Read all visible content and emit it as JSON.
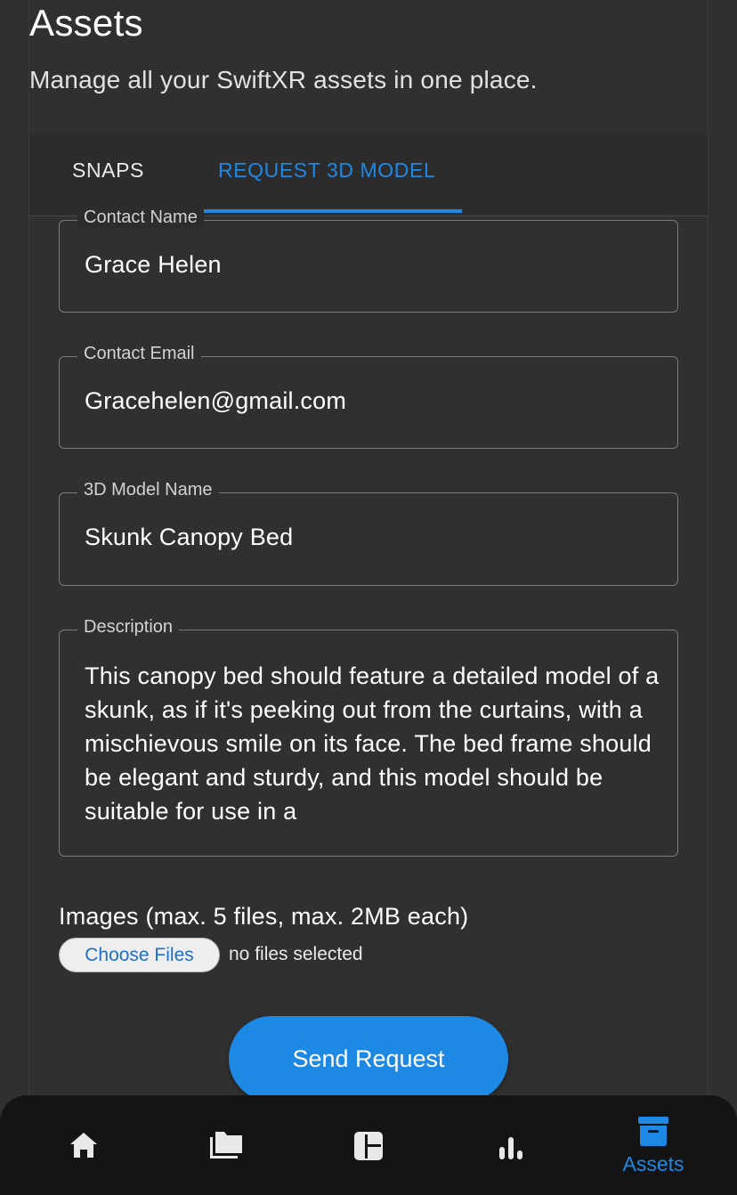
{
  "header": {
    "title": "Assets",
    "subtitle": "Manage all your SwiftXR assets in one place."
  },
  "tabs": [
    {
      "label": "SNAPS",
      "active": false
    },
    {
      "label": "REQUEST 3D MODEL",
      "active": true
    }
  ],
  "form": {
    "contact_name": {
      "label": "Contact Name",
      "value": "Grace Helen"
    },
    "contact_email": {
      "label": "Contact Email",
      "value": "Gracehelen@gmail.com"
    },
    "model_name": {
      "label": "3D Model Name",
      "value": "Skunk Canopy Bed"
    },
    "description": {
      "label": "Description",
      "value": "This canopy bed should feature a detailed model of a skunk, as if it's peeking out from the curtains, with a mischievous smile on its face. The bed frame should be elegant and sturdy, and this model should be suitable for use in a"
    },
    "images": {
      "label": "Images (max. 5 files, max. 2MB each)",
      "button_label": "Choose Files",
      "status": "no files selected"
    },
    "submit_label": "Send Request"
  },
  "bottom_nav": {
    "items": [
      {
        "icon": "home-icon",
        "label": ""
      },
      {
        "icon": "folders-icon",
        "label": ""
      },
      {
        "icon": "dashboard-icon",
        "label": ""
      },
      {
        "icon": "bar-chart-icon",
        "label": ""
      },
      {
        "icon": "archive-icon",
        "label": "Assets",
        "active": true
      }
    ]
  },
  "colors": {
    "accent": "#1e88e5",
    "background": "#303030",
    "nav_background": "#141414"
  }
}
